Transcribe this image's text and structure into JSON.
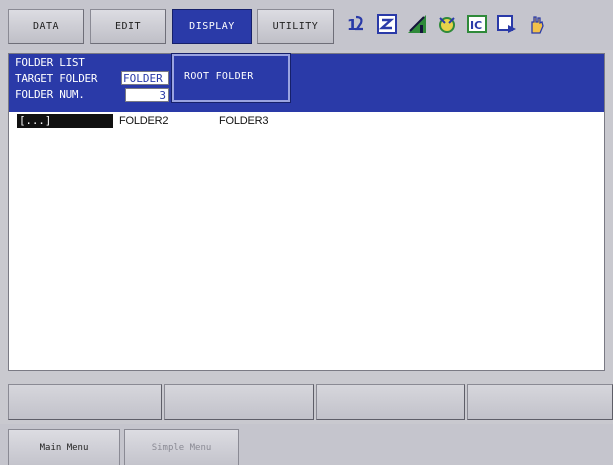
{
  "menu": {
    "tabs": [
      {
        "label": "DATA"
      },
      {
        "label": "EDIT"
      },
      {
        "label": "DISPLAY"
      },
      {
        "label": "UTILITY"
      }
    ],
    "active_tab": "DISPLAY",
    "icons": [
      "job-step-icon",
      "edit-mode-icon",
      "signal-icon",
      "gear-robot-icon",
      "io-icon",
      "play-icon",
      "hand-icon"
    ]
  },
  "panel": {
    "title": "FOLDER LIST",
    "target_label": "TARGET FOLDER",
    "target_value": "FOLDER",
    "num_label": "FOLDER NUM.",
    "num_value": "3",
    "folders": [
      "[...]",
      "FOLDER2",
      "FOLDER3"
    ]
  },
  "dropdown": {
    "items": [
      "ROOT FOLDER"
    ]
  },
  "function_keys": [
    "",
    "",
    "",
    ""
  ],
  "bottom": {
    "main_menu": "Main Menu",
    "simple_menu": "Simple Menu"
  },
  "colors": {
    "accent": "#2a3aa8",
    "panel_bg": "#ffffff",
    "chrome": "#c5c5cd"
  }
}
